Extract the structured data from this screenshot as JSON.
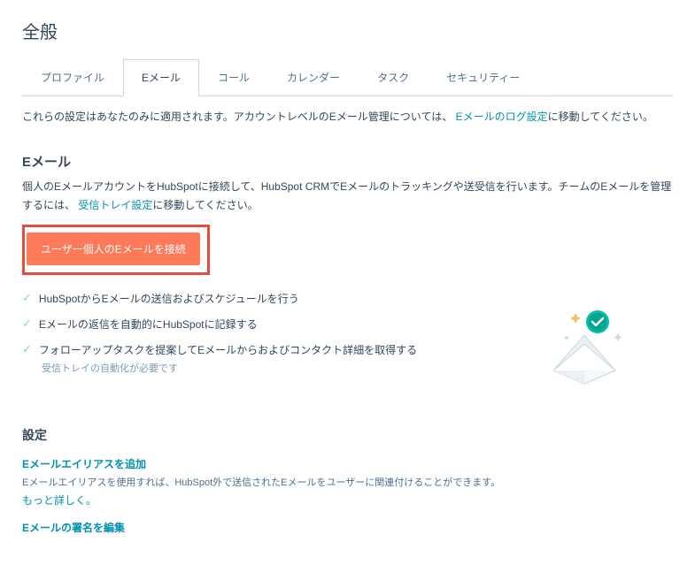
{
  "page_title": "全般",
  "tabs": [
    {
      "label": "プロファイル"
    },
    {
      "label": "Eメール"
    },
    {
      "label": "コール"
    },
    {
      "label": "カレンダー"
    },
    {
      "label": "タスク"
    },
    {
      "label": "セキュリティー"
    }
  ],
  "active_tab_index": 1,
  "description": {
    "prefix": "これらの設定はあなたのみに適用されます。アカウントレベルのEメール管理については、",
    "link": "Eメールのログ設定",
    "suffix": "に移動してください。"
  },
  "email_section": {
    "title": "Eメール",
    "desc_prefix": "個人のEメールアカウントをHubSpotに接続して、HubSpot CRMでEメールのトラッキングや送受信を行います。チームのEメールを管理するには、",
    "desc_link": "受信トレイ設定",
    "desc_suffix": "に移動してください。",
    "connect_button": "ユーザー個人のEメールを接続",
    "features": [
      "HubSpotからEメールの送信およびスケジュールを行う",
      "Eメールの返信を自動的にHubSpotに記録する",
      "フォローアップタスクを提案してEメールからおよびコンタクト詳細を取得する"
    ],
    "feature_note": "受信トレイの自動化が必要です"
  },
  "settings_section": {
    "title": "設定",
    "items": [
      {
        "link": "Eメールエイリアスを追加",
        "desc": "Eメールエイリアスを使用すれば、HubSpot外で送信されたEメールをユーザーに関連付けることができます。",
        "more": "もっと詳しく。"
      },
      {
        "link": "Eメールの署名を編集"
      }
    ]
  }
}
